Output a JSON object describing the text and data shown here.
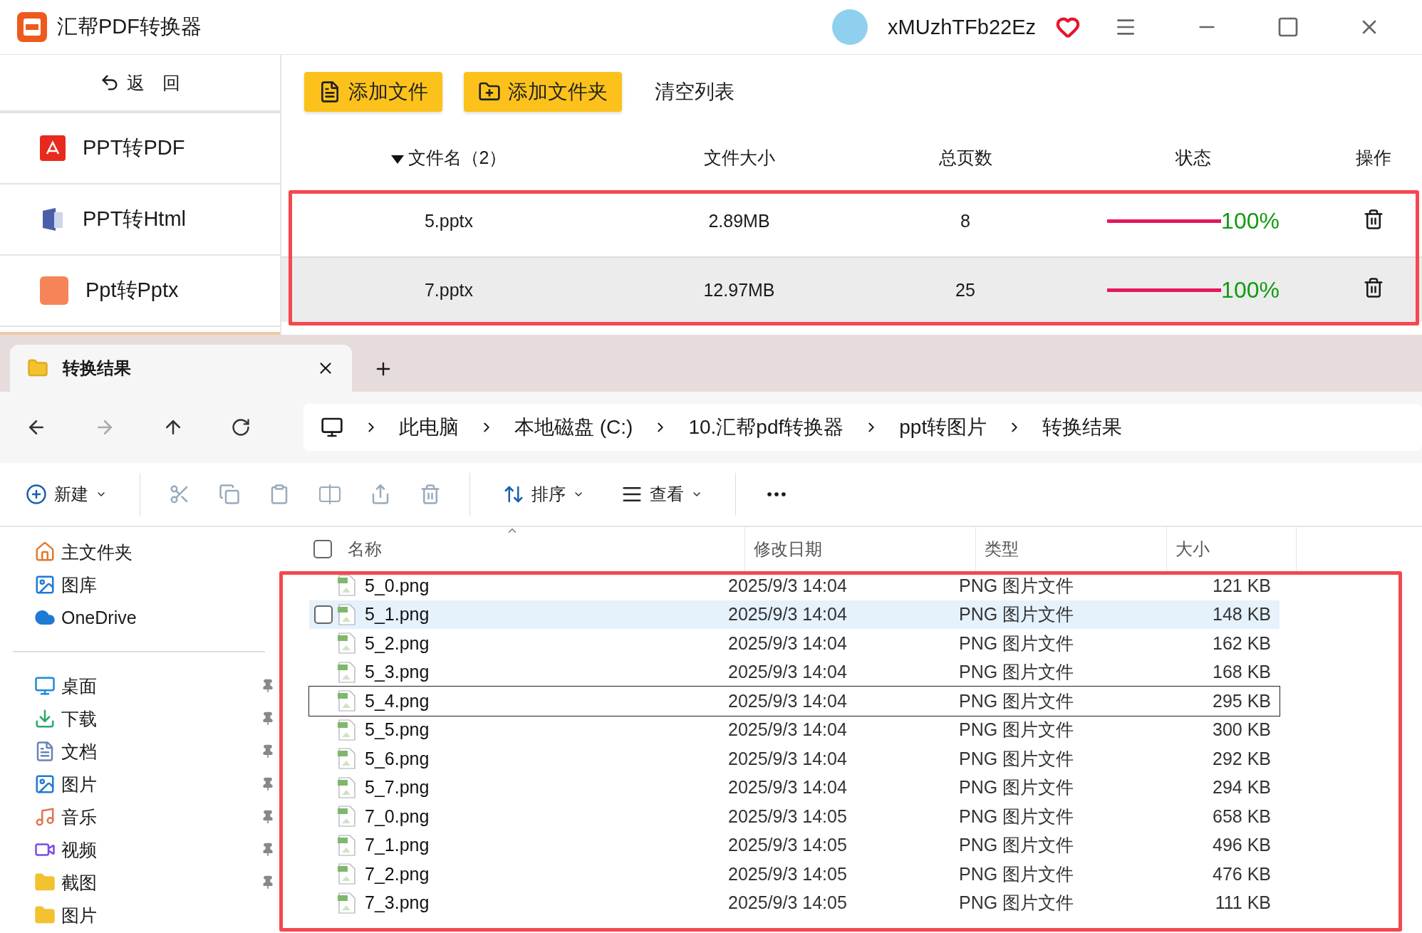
{
  "app": {
    "title": "汇帮PDF转换器",
    "user": "xMUzhTFb22Ez",
    "back": "返　回",
    "sidebar": [
      {
        "label": "PPT转PDF"
      },
      {
        "label": "PPT转Html"
      },
      {
        "label": "Ppt转Pptx"
      }
    ],
    "buttons": [
      "添加文件",
      "添加文件夹"
    ],
    "clear": "清空列表",
    "columns": [
      "文件名（2）",
      "文件大小",
      "总页数",
      "状态",
      "操作"
    ],
    "rows": [
      {
        "name": "5.pptx",
        "size": "2.89MB",
        "pages": "8",
        "level": 1,
        "status": "100%",
        "selected": false
      },
      {
        "name": "7.pptx",
        "size": "12.97MB",
        "pages": "25",
        "level": 1,
        "status": "100%",
        "selected": true
      }
    ]
  },
  "explorer": {
    "tab": "转换结果",
    "path": [
      "此电脑",
      "本地磁盘 (C:)",
      "10.汇帮pdf转换器",
      "ppt转图片",
      "转换结果"
    ],
    "commands": [
      {
        "label": "新建"
      },
      {
        "label": "排序"
      },
      {
        "label": "查看"
      }
    ],
    "nav_top": [
      "主文件夹",
      "图库",
      "OneDrive"
    ],
    "nav_pinned": [
      {
        "label": "桌面",
        "pinned": true
      },
      {
        "label": "下载",
        "pinned": true
      },
      {
        "label": "文档",
        "pinned": true
      },
      {
        "label": "图片",
        "pinned": true
      },
      {
        "label": "音乐",
        "pinned": true
      },
      {
        "label": "视频",
        "pinned": true
      },
      {
        "label": "截图",
        "pinned": true
      },
      {
        "label": "图片",
        "pinned": false
      }
    ],
    "select_all": {
      "checked": false
    },
    "columns": [
      "名称",
      "修改日期",
      "类型",
      "大小"
    ],
    "files": [
      {
        "name": "5_0.png",
        "date": "2025/9/3 14:04",
        "type": "PNG 图片文件",
        "size": "121 KB",
        "hovered": false,
        "focused": false
      },
      {
        "name": "5_1.png",
        "date": "2025/9/3 14:04",
        "type": "PNG 图片文件",
        "size": "148 KB",
        "hovered": true,
        "focused": false
      },
      {
        "name": "5_2.png",
        "date": "2025/9/3 14:04",
        "type": "PNG 图片文件",
        "size": "162 KB",
        "hovered": false,
        "focused": false
      },
      {
        "name": "5_3.png",
        "date": "2025/9/3 14:04",
        "type": "PNG 图片文件",
        "size": "168 KB",
        "hovered": false,
        "focused": false
      },
      {
        "name": "5_4.png",
        "date": "2025/9/3 14:04",
        "type": "PNG 图片文件",
        "size": "295 KB",
        "hovered": false,
        "focused": true
      },
      {
        "name": "5_5.png",
        "date": "2025/9/3 14:04",
        "type": "PNG 图片文件",
        "size": "300 KB",
        "hovered": false,
        "focused": false
      },
      {
        "name": "5_6.png",
        "date": "2025/9/3 14:04",
        "type": "PNG 图片文件",
        "size": "292 KB",
        "hovered": false,
        "focused": false
      },
      {
        "name": "5_7.png",
        "date": "2025/9/3 14:04",
        "type": "PNG 图片文件",
        "size": "294 KB",
        "hovered": false,
        "focused": false
      },
      {
        "name": "7_0.png",
        "date": "2025/9/3 14:05",
        "type": "PNG 图片文件",
        "size": "658 KB",
        "hovered": false,
        "focused": false
      },
      {
        "name": "7_1.png",
        "date": "2025/9/3 14:05",
        "type": "PNG 图片文件",
        "size": "496 KB",
        "hovered": false,
        "focused": false
      },
      {
        "name": "7_2.png",
        "date": "2025/9/3 14:05",
        "type": "PNG 图片文件",
        "size": "476 KB",
        "hovered": false,
        "focused": false
      },
      {
        "name": "7_3.png",
        "date": "2025/9/3 14:05",
        "type": "PNG 图片文件",
        "size": "111 KB",
        "hovered": false,
        "focused": false
      }
    ]
  }
}
